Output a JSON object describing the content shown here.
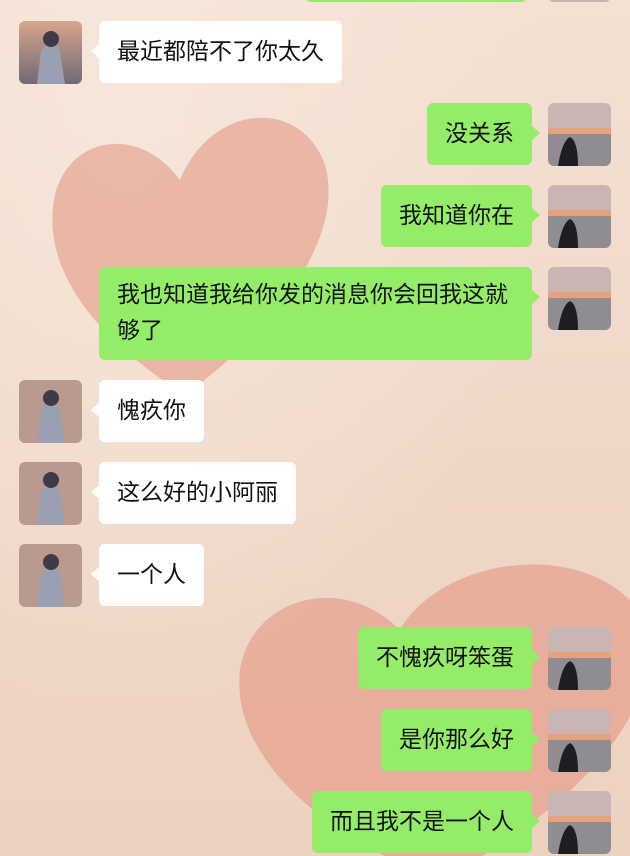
{
  "contacts": {
    "other_avatar": "anime-character-avatar",
    "me_avatar": "girl-by-sea-avatar"
  },
  "colors": {
    "outgoing_bubble": "#95ec69",
    "incoming_bubble": "#ffffff",
    "heart": "#e59a85"
  },
  "messages": [
    {
      "from": "other",
      "text": "最近都陪不了你太久"
    },
    {
      "from": "me",
      "text": "没关系"
    },
    {
      "from": "me",
      "text": "我知道你在"
    },
    {
      "from": "me",
      "text": "我也知道我给你发的消息你会回我这就够了"
    },
    {
      "from": "other",
      "text": "愧疚你"
    },
    {
      "from": "other",
      "text": "这么好的小阿丽"
    },
    {
      "from": "other",
      "text": "一个人"
    },
    {
      "from": "me",
      "text": "不愧疚呀笨蛋"
    },
    {
      "from": "me",
      "text": "是你那么好"
    },
    {
      "from": "me",
      "text": "而且我不是一个人"
    }
  ]
}
